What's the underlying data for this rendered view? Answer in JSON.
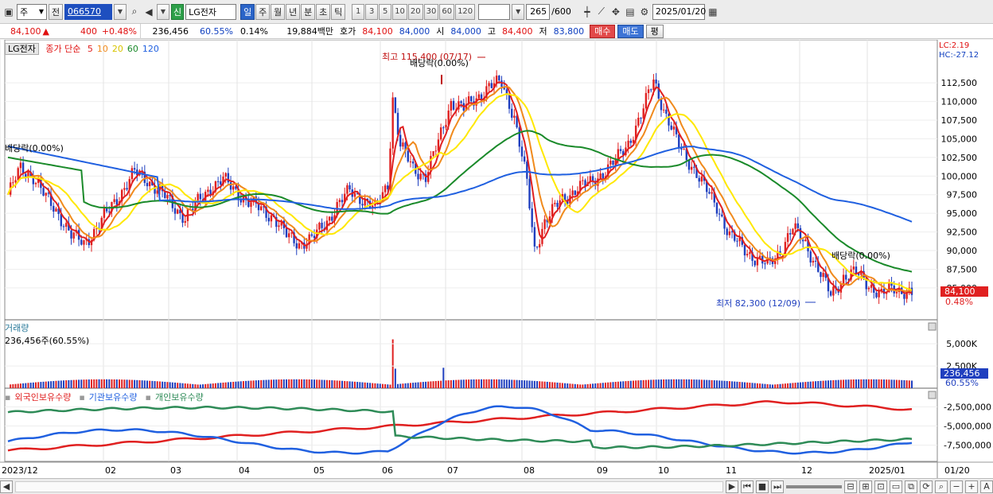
{
  "toolbar": {
    "period_select": "주",
    "prev_label": "전",
    "code": "066570",
    "stock_badge": "신",
    "stock_name": "LG전자",
    "periods": [
      "일",
      "주",
      "월",
      "년",
      "분",
      "초",
      "틱"
    ],
    "active_period": "일",
    "intervals": [
      "1",
      "3",
      "5",
      "10",
      "20",
      "30",
      "60",
      "120"
    ],
    "count": "265",
    "total": "/600",
    "date": "2025/01/20"
  },
  "info": {
    "price": "84,100",
    "change_arrow": "▲",
    "change": "400",
    "change_pct": "+0.48%",
    "volume": "236,456",
    "vol_ratio": "60.55%",
    "turnover": "0.14%",
    "amount": "19,884백만",
    "quote_label": "호가",
    "ask": "84,100",
    "bid": "84,000",
    "open_label": "시",
    "open": "84,000",
    "high_label": "고",
    "high": "84,400",
    "low_label": "저",
    "low": "83,800",
    "buy_button": "매수",
    "sell_button": "매도",
    "eval_button": "평"
  },
  "legend": {
    "stock": "LG전자",
    "close_label": "종가 단순",
    "ma": [
      {
        "label": "5",
        "color": "#e02020"
      },
      {
        "label": "10",
        "color": "#f08a1c"
      },
      {
        "label": "20",
        "color": "#ffe800"
      },
      {
        "label": "60",
        "color": "#1a8a2a"
      },
      {
        "label": "120",
        "color": "#2060e0"
      }
    ]
  },
  "annotations": {
    "lc": "LC:2.19",
    "hc": "HC:-27.12",
    "high_marker": "최고 115,400 (07/17)",
    "low_marker": "최저 82,300 (12/09)",
    "dividend_left": "배당락(0.00%)",
    "dividend_mid": "배당락(0.00%)",
    "dividend_right": "배당락(0.00%)",
    "price_tag": "84,100",
    "pct_tag": "0.48%"
  },
  "volume_panel": {
    "title": "거래량",
    "value": "236,456주(60.55%)",
    "axis": [
      "5,000K",
      "2,500K"
    ],
    "tag": "236,456",
    "tag_pct": "60.55%"
  },
  "holding_panel": {
    "legend": [
      {
        "label": "외국인보유수량",
        "color": "#e02020"
      },
      {
        "label": "기관보유수량",
        "color": "#2060e0"
      },
      {
        "label": "개인보유수량",
        "color": "#2e8b57"
      }
    ],
    "axis": [
      "-2,500,000",
      "-5,000,000",
      "-7,500,000"
    ]
  },
  "x_axis": [
    "2023/12",
    "02",
    "03",
    "04",
    "05",
    "06",
    "07",
    "08",
    "09",
    "10",
    "11",
    "12",
    "2025/01",
    "01/20"
  ],
  "chart_data": {
    "type": "line",
    "title": "LG전자",
    "ylim": [
      82000,
      117000
    ],
    "y_ticks": [
      "112,500",
      "110,000",
      "107,500",
      "105,000",
      "102,500",
      "100,000",
      "97,500",
      "95,000",
      "92,500",
      "90,000",
      "87,500",
      "85,000"
    ],
    "price_points": [
      [
        0,
        97500
      ],
      [
        5,
        101000
      ],
      [
        10,
        100000
      ],
      [
        15,
        97000
      ],
      [
        20,
        95000
      ],
      [
        25,
        92000
      ],
      [
        30,
        91000
      ],
      [
        35,
        93000
      ],
      [
        40,
        95500
      ],
      [
        45,
        98000
      ],
      [
        50,
        100500
      ],
      [
        55,
        99500
      ],
      [
        60,
        98000
      ],
      [
        65,
        96000
      ],
      [
        70,
        94500
      ],
      [
        75,
        96500
      ],
      [
        80,
        98500
      ],
      [
        85,
        99500
      ],
      [
        90,
        98000
      ],
      [
        95,
        96500
      ],
      [
        100,
        95500
      ],
      [
        105,
        94500
      ],
      [
        110,
        92000
      ],
      [
        115,
        91000
      ],
      [
        120,
        91500
      ],
      [
        125,
        93500
      ],
      [
        130,
        96000
      ],
      [
        135,
        98000
      ],
      [
        140,
        97000
      ],
      [
        145,
        95500
      ],
      [
        150,
        99000
      ],
      [
        152,
        110500
      ],
      [
        155,
        104000
      ],
      [
        160,
        101000
      ],
      [
        165,
        100000
      ],
      [
        170,
        104500
      ],
      [
        175,
        110000
      ],
      [
        180,
        109000
      ],
      [
        185,
        110500
      ],
      [
        190,
        112000
      ],
      [
        195,
        112500
      ],
      [
        200,
        108000
      ],
      [
        205,
        99000
      ],
      [
        208,
        90000
      ],
      [
        212,
        94000
      ],
      [
        218,
        96500
      ],
      [
        225,
        98500
      ],
      [
        230,
        99000
      ],
      [
        235,
        100500
      ],
      [
        240,
        102000
      ],
      [
        245,
        104500
      ],
      [
        250,
        108000
      ],
      [
        255,
        113000
      ],
      [
        260,
        108000
      ],
      [
        265,
        104000
      ],
      [
        270,
        101500
      ],
      [
        275,
        98500
      ],
      [
        280,
        96000
      ],
      [
        285,
        92000
      ],
      [
        290,
        90500
      ],
      [
        295,
        89000
      ],
      [
        300,
        88000
      ],
      [
        305,
        90000
      ],
      [
        310,
        93000
      ],
      [
        315,
        91000
      ],
      [
        320,
        87500
      ],
      [
        325,
        84000
      ],
      [
        330,
        86500
      ],
      [
        335,
        87000
      ],
      [
        340,
        85500
      ],
      [
        345,
        84000
      ],
      [
        350,
        85000
      ],
      [
        355,
        84500
      ],
      [
        357,
        84100
      ]
    ],
    "volume_ylim": [
      0,
      6000000
    ],
    "holding_ylim": [
      -9000000,
      -1000000
    ]
  }
}
